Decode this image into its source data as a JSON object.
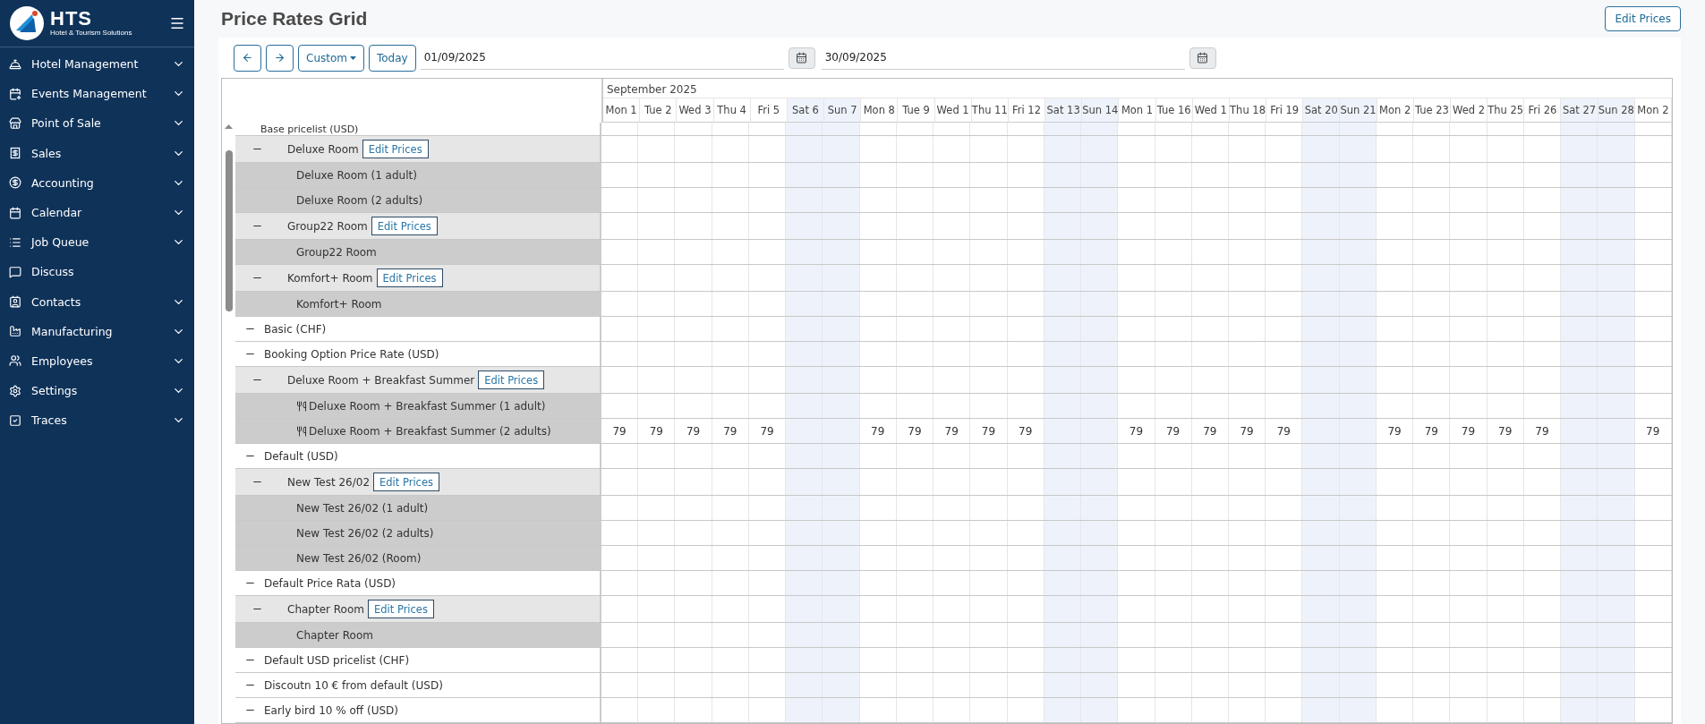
{
  "sidebar": {
    "brand": "HTS",
    "tagline": "Hotel & Tourism Solutions",
    "items": [
      {
        "label": "Hotel Management",
        "expandable": true
      },
      {
        "label": "Events Management",
        "expandable": true
      },
      {
        "label": "Point of Sale",
        "expandable": true
      },
      {
        "label": "Sales",
        "expandable": true
      },
      {
        "label": "Accounting",
        "expandable": true
      },
      {
        "label": "Calendar",
        "expandable": true
      },
      {
        "label": "Job Queue",
        "expandable": true
      },
      {
        "label": "Discuss",
        "expandable": false
      },
      {
        "label": "Contacts",
        "expandable": true
      },
      {
        "label": "Manufacturing",
        "expandable": true
      },
      {
        "label": "Employees",
        "expandable": true
      },
      {
        "label": "Settings",
        "expandable": true
      },
      {
        "label": "Traces",
        "expandable": true
      }
    ]
  },
  "page": {
    "title": "Price Rates Grid",
    "edit_button": "Edit Prices"
  },
  "toolbar": {
    "range": "Custom",
    "today": "Today",
    "start_date": "01/09/2025",
    "end_date": "30/09/2025"
  },
  "grid": {
    "month": "September 2025",
    "days": [
      {
        "label": "Mon 1",
        "weekend": false
      },
      {
        "label": "Tue 2",
        "weekend": false
      },
      {
        "label": "Wed 3",
        "weekend": false
      },
      {
        "label": "Thu 4",
        "weekend": false
      },
      {
        "label": "Fri 5",
        "weekend": false
      },
      {
        "label": "Sat 6",
        "weekend": true
      },
      {
        "label": "Sun 7",
        "weekend": true
      },
      {
        "label": "Mon 8",
        "weekend": false
      },
      {
        "label": "Tue 9",
        "weekend": false
      },
      {
        "label": "Wed 1",
        "weekend": false
      },
      {
        "label": "Thu 11",
        "weekend": false
      },
      {
        "label": "Fri 12",
        "weekend": false
      },
      {
        "label": "Sat 13",
        "weekend": true
      },
      {
        "label": "Sun 14",
        "weekend": true
      },
      {
        "label": "Mon 1",
        "weekend": false
      },
      {
        "label": "Tue 16",
        "weekend": false
      },
      {
        "label": "Wed 1",
        "weekend": false
      },
      {
        "label": "Thu 18",
        "weekend": false
      },
      {
        "label": "Fri 19",
        "weekend": false
      },
      {
        "label": "Sat 20",
        "weekend": true
      },
      {
        "label": "Sun 21",
        "weekend": true
      },
      {
        "label": "Mon 2",
        "weekend": false
      },
      {
        "label": "Tue 23",
        "weekend": false
      },
      {
        "label": "Wed 2",
        "weekend": false
      },
      {
        "label": "Thu 25",
        "weekend": false
      },
      {
        "label": "Fri 26",
        "weekend": false
      },
      {
        "label": "Sat 27",
        "weekend": true
      },
      {
        "label": "Sun 28",
        "weekend": true
      },
      {
        "label": "Mon 2",
        "weekend": false
      }
    ],
    "rows": [
      {
        "kind": "partial",
        "label": "Base pricelist (USD)"
      },
      {
        "kind": "room",
        "label": "Deluxe Room",
        "edit_button": "Edit Prices"
      },
      {
        "kind": "variant",
        "label": "Deluxe Room (1 adult)",
        "breakfast": false
      },
      {
        "kind": "variant",
        "label": "Deluxe Room (2 adults)",
        "breakfast": false
      },
      {
        "kind": "room",
        "label": "Group22 Room",
        "edit_button": "Edit Prices"
      },
      {
        "kind": "variant",
        "label": "Group22 Room",
        "breakfast": false
      },
      {
        "kind": "room",
        "label": "Komfort+ Room",
        "edit_button": "Edit Prices"
      },
      {
        "kind": "variant",
        "label": "Komfort+ Room",
        "breakfast": false
      },
      {
        "kind": "pricelist",
        "label": "Basic (CHF)"
      },
      {
        "kind": "pricelist",
        "label": "Booking Option Price Rate (USD)"
      },
      {
        "kind": "room",
        "label": "Deluxe Room + Breakfast Summer",
        "edit_button": "Edit Prices"
      },
      {
        "kind": "variant",
        "label": "Deluxe Room + Breakfast Summer (1 adult)",
        "breakfast": true
      },
      {
        "kind": "variant",
        "label": "Deluxe Room + Breakfast Summer (2 adults)",
        "breakfast": true,
        "weekday_prices": [
          "79",
          "79",
          "79",
          "79",
          "79",
          "79",
          "79",
          "79",
          "79",
          "79",
          "79",
          "79",
          "79",
          "79",
          "79",
          "79",
          "79",
          "79",
          "79",
          "79",
          "79"
        ]
      },
      {
        "kind": "pricelist",
        "label": "Default (USD)"
      },
      {
        "kind": "room",
        "label": "New Test 26/02",
        "edit_button": "Edit Prices"
      },
      {
        "kind": "variant",
        "label": "New Test 26/02 (1 adult)",
        "breakfast": false
      },
      {
        "kind": "variant",
        "label": "New Test 26/02 (2 adults)",
        "breakfast": false
      },
      {
        "kind": "variant",
        "label": "New Test 26/02 (Room)",
        "breakfast": false
      },
      {
        "kind": "pricelist",
        "label": "Default Price Rata (USD)"
      },
      {
        "kind": "room",
        "label": "Chapter Room",
        "edit_button": "Edit Prices"
      },
      {
        "kind": "variant",
        "label": "Chapter Room",
        "breakfast": false
      },
      {
        "kind": "pricelist",
        "label": "Default USD pricelist (CHF)"
      },
      {
        "kind": "pricelist",
        "label": "Discoutn 10 € from default (USD)"
      },
      {
        "kind": "pricelist",
        "label": "Early bird 10 % off (USD)"
      }
    ]
  }
}
